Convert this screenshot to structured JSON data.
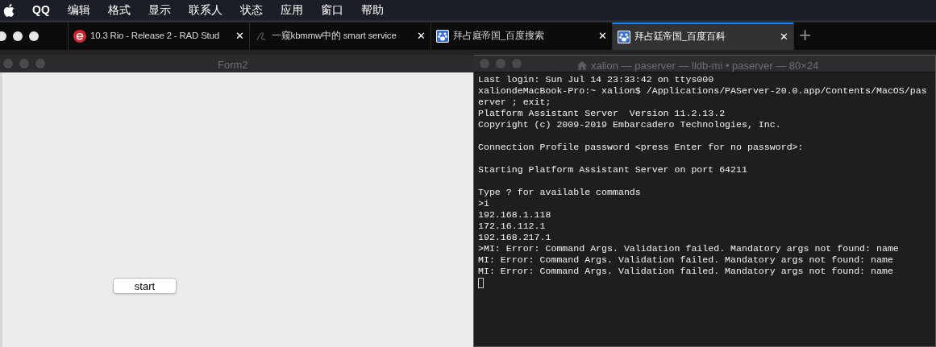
{
  "menu_bar": {
    "app": "QQ",
    "items": [
      "编辑",
      "格式",
      "显示",
      "联系人",
      "状态",
      "应用",
      "窗口",
      "帮助"
    ]
  },
  "browser_tabs": [
    {
      "title": "10.3 Rio - Release 2 - RAD Stud",
      "close": "✕",
      "kind": "e-logo",
      "selected": false
    },
    {
      "title": "一窥kbmmw中的 smart service",
      "close": "✕",
      "kind": "glyph",
      "selected": false
    },
    {
      "title": "拜占庭帝国_百度搜索",
      "close": "✕",
      "kind": "paw",
      "selected": false
    },
    {
      "title": "拜占廷帝国_百度百科",
      "close": "✕",
      "kind": "paw",
      "selected": true
    }
  ],
  "new_tab": "+",
  "form_window": {
    "title": "Form2",
    "button": "start"
  },
  "terminal": {
    "title": "xalion — paserver — lldb-mi • paserver — 80×24",
    "cursor": true,
    "blocks": [
      [
        "Last login: Sun Jul 14 23:33:42 on ttys000",
        "xaliondeMacBook-Pro:~ xalion$ /Applications/PAServer-20.0.app/Contents/MacOS/pas",
        "erver ; exit;",
        "Platform Assistant Server  Version 11.2.13.2",
        "Copyright (c) 2009-2019 Embarcadero Technologies, Inc."
      ],
      [
        "Connection Profile password <press Enter for no password>:"
      ],
      [
        "Starting Platform Assistant Server on port 64211"
      ],
      [
        "Type ? for available commands",
        ">i",
        "192.168.1.118",
        "172.16.112.1",
        "192.168.217.1",
        ">MI: Error: Command Args. Validation failed. Mandatory args not found: name",
        "MI: Error: Command Args. Validation failed. Mandatory args not found: name",
        "MI: Error: Command Args. Validation failed. Mandatory args not found: name"
      ]
    ]
  }
}
